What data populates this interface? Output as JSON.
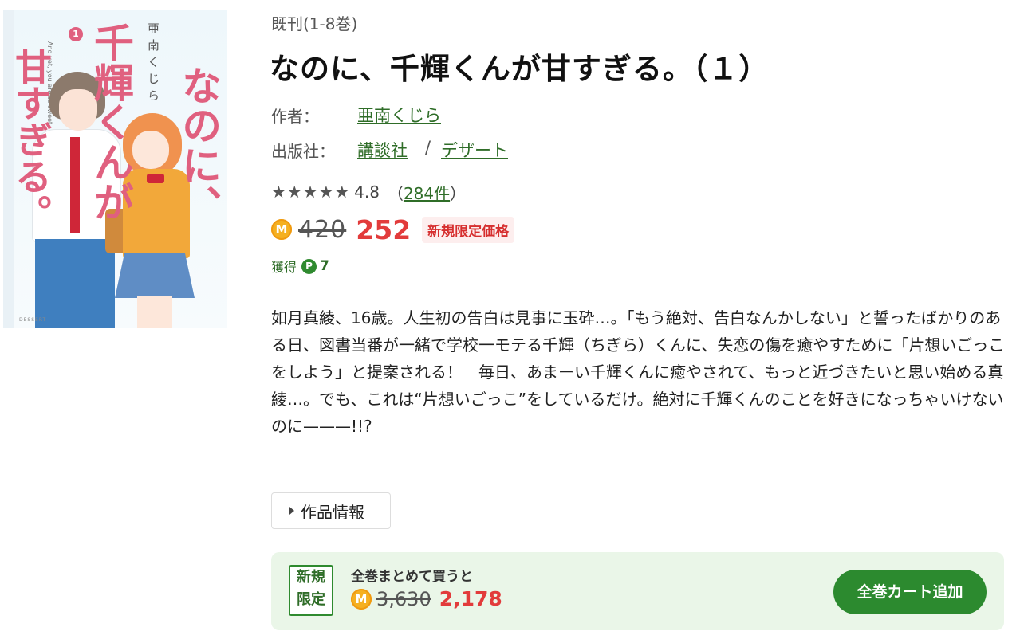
{
  "cover": {
    "title_vertical_1": "千輝くんが",
    "title_vertical_2": "甘すぎる。",
    "title_vertical_3": "なのに、",
    "author_vertical": "亜南くじら",
    "volume_badge": "1",
    "subtitle_en": "And yet, you are so sweet.",
    "publisher_mark": "DESSERT"
  },
  "product": {
    "status": "既刊(1-8巻)",
    "title": "なのに、千輝くんが甘すぎる。（１）",
    "author_label": "作者：",
    "author_name": "亜南くじら",
    "publisher_label": "出版社：",
    "publisher_name": "講談社",
    "separator": "/",
    "label_name": "デザート"
  },
  "rating": {
    "stars": 5,
    "value": "4.8",
    "count_open": "（",
    "count_link": "284件",
    "count_close": "）"
  },
  "price": {
    "coin_symbol": "M",
    "original": "420",
    "sale": "252",
    "badge": "新規限定価格"
  },
  "points": {
    "label": "獲得",
    "icon": "P",
    "value": "7"
  },
  "description": "如月真綾、16歳。人生初の告白は見事に玉砕…。「もう絶対、告白なんかしない」と誓ったばかりのある日、図書当番が一緒で学校一モテる千輝（ちぎら）くんに、失恋の傷を癒やすために「片想いごっこをしよう」と提案される！　毎日、あまーい千輝くんに癒やされて、もっと近づきたいと思い始める真綾…。でも、これは“片想いごっこ”をしているだけ。絶対に千輝くんのことを好きになっちゃいけないのに———!!?",
  "info_button": {
    "label": "作品情報"
  },
  "bundle": {
    "tag_line1": "新規",
    "tag_line2": "限定",
    "caption": "全巻まとめて買うと",
    "coin_symbol": "M",
    "original": "3,630",
    "sale": "2,178",
    "cart_button": "全巻カート追加"
  },
  "colors": {
    "link_green": "#2f6d28",
    "sale_red": "#e23b3b",
    "coin_orange": "#f5b021",
    "bundle_bg": "#eaf6e8",
    "cart_button_bg": "#2c8a2f"
  }
}
